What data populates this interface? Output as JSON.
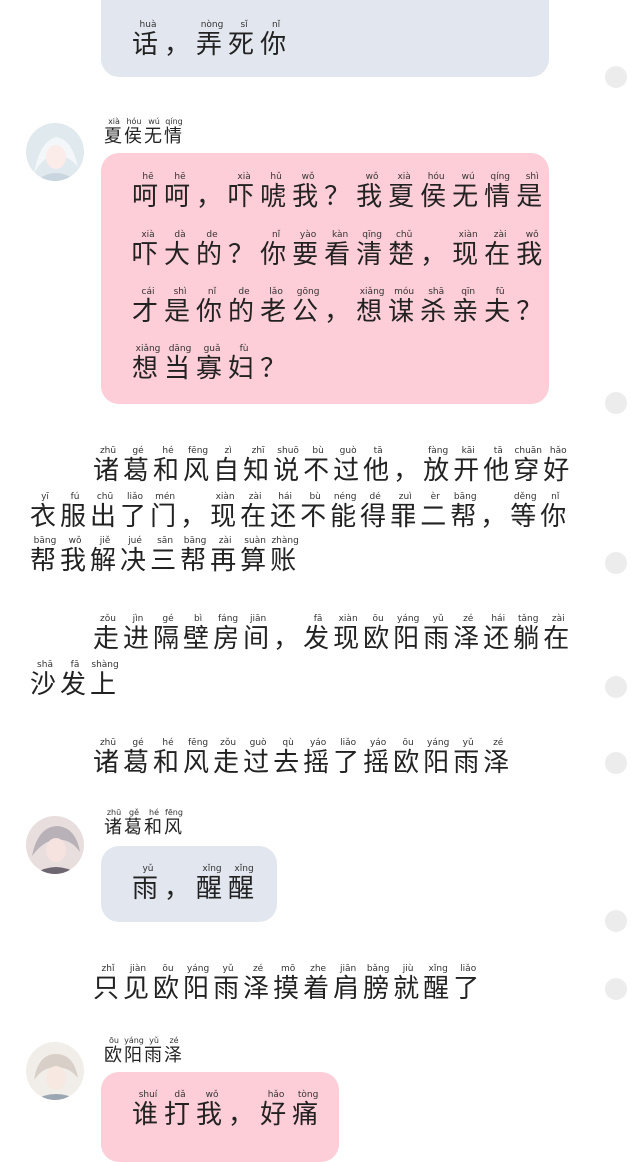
{
  "messages": {
    "m0": {
      "line1": [
        [
          "话",
          "huà"
        ],
        [
          "，",
          ""
        ],
        [
          "弄",
          "nòng"
        ],
        [
          "死",
          "sǐ"
        ],
        [
          "你",
          "nǐ"
        ]
      ]
    },
    "m1": {
      "name": [
        [
          "夏",
          "xià"
        ],
        [
          "侯",
          "hóu"
        ],
        [
          "无",
          "wú"
        ],
        [
          "情",
          "qíng"
        ]
      ],
      "line1": [
        [
          "呵",
          "hē"
        ],
        [
          "呵",
          "hē"
        ],
        [
          "，",
          ""
        ],
        [
          "吓",
          "xià"
        ],
        [
          "唬",
          "hǔ"
        ],
        [
          "我",
          "wǒ"
        ],
        [
          "？",
          ""
        ],
        [
          "我",
          "wǒ"
        ],
        [
          "夏",
          "xià"
        ],
        [
          "侯",
          "hóu"
        ],
        [
          "无",
          "wú"
        ],
        [
          "情",
          "qíng"
        ],
        [
          "是",
          "shì"
        ]
      ],
      "line2": [
        [
          "吓",
          "xià"
        ],
        [
          "大",
          "dà"
        ],
        [
          "的",
          "de"
        ],
        [
          "？",
          ""
        ],
        [
          "你",
          "nǐ"
        ],
        [
          "要",
          "yào"
        ],
        [
          "看",
          "kàn"
        ],
        [
          "清",
          "qīng"
        ],
        [
          "楚",
          "chǔ"
        ],
        [
          "，",
          ""
        ],
        [
          "现",
          "xiàn"
        ],
        [
          "在",
          "zài"
        ],
        [
          "我",
          "wǒ"
        ]
      ],
      "line3": [
        [
          "才",
          "cái"
        ],
        [
          "是",
          "shì"
        ],
        [
          "你",
          "nǐ"
        ],
        [
          "的",
          "de"
        ],
        [
          "老",
          "lǎo"
        ],
        [
          "公",
          "gōng"
        ],
        [
          "，",
          ""
        ],
        [
          "想",
          "xiǎng"
        ],
        [
          "谋",
          "móu"
        ],
        [
          "杀",
          "shā"
        ],
        [
          "亲",
          "qīn"
        ],
        [
          "夫",
          "fū"
        ],
        [
          "？",
          ""
        ]
      ],
      "line4": [
        [
          "想",
          "xiǎng"
        ],
        [
          "当",
          "dāng"
        ],
        [
          "寡",
          "guǎ"
        ],
        [
          "妇",
          "fù"
        ],
        [
          "？",
          ""
        ]
      ]
    },
    "m2": {
      "name": [
        [
          "诸",
          "zhū"
        ],
        [
          "葛",
          "gě"
        ],
        [
          "和",
          "hé"
        ],
        [
          "风",
          "fēng"
        ]
      ],
      "line1": [
        [
          "雨",
          "yǔ"
        ],
        [
          "，",
          ""
        ],
        [
          "醒",
          "xǐng"
        ],
        [
          "醒",
          "xǐng"
        ]
      ]
    },
    "m3": {
      "name": [
        [
          "欧",
          "ōu"
        ],
        [
          "阳",
          "yáng"
        ],
        [
          "雨",
          "yǔ"
        ],
        [
          "泽",
          "zé"
        ]
      ],
      "line1": [
        [
          "谁",
          "shuí"
        ],
        [
          "打",
          "dǎ"
        ],
        [
          "我",
          "wǒ"
        ],
        [
          "，",
          ""
        ],
        [
          "好",
          "hǎo"
        ],
        [
          "痛",
          "tòng"
        ]
      ]
    }
  },
  "narration": {
    "p1": {
      "line1": [
        [
          "诸",
          "zhū"
        ],
        [
          "葛",
          "gé"
        ],
        [
          "和",
          "hé"
        ],
        [
          "风",
          "fēng"
        ],
        [
          "自",
          "zì"
        ],
        [
          "知",
          "zhī"
        ],
        [
          "说",
          "shuō"
        ],
        [
          "不",
          "bù"
        ],
        [
          "过",
          "guò"
        ],
        [
          "他",
          "tā"
        ],
        [
          "，",
          ""
        ],
        [
          "放",
          "fàng"
        ],
        [
          "开",
          "kāi"
        ],
        [
          "他",
          "tā"
        ],
        [
          "穿",
          "chuān"
        ],
        [
          "好",
          "hǎo"
        ]
      ],
      "line2": [
        [
          "衣",
          "yī"
        ],
        [
          "服",
          "fú"
        ],
        [
          "出",
          "chū"
        ],
        [
          "了",
          "liǎo"
        ],
        [
          "门",
          "mén"
        ],
        [
          "，",
          ""
        ],
        [
          "现",
          "xiàn"
        ],
        [
          "在",
          "zài"
        ],
        [
          "还",
          "hái"
        ],
        [
          "不",
          "bù"
        ],
        [
          "能",
          "néng"
        ],
        [
          "得",
          "dé"
        ],
        [
          "罪",
          "zuì"
        ],
        [
          "二",
          "èr"
        ],
        [
          "帮",
          "bāng"
        ],
        [
          "，",
          ""
        ],
        [
          "等",
          "děng"
        ],
        [
          "你",
          "nǐ"
        ]
      ],
      "line3": [
        [
          "帮",
          "bāng"
        ],
        [
          "我",
          "wǒ"
        ],
        [
          "解",
          "jiě"
        ],
        [
          "决",
          "jué"
        ],
        [
          "三",
          "sān"
        ],
        [
          "帮",
          "bāng"
        ],
        [
          "再",
          "zài"
        ],
        [
          "算",
          "suàn"
        ],
        [
          "账",
          "zhàng"
        ]
      ]
    },
    "p2": {
      "line1": [
        [
          "走",
          "zǒu"
        ],
        [
          "进",
          "jìn"
        ],
        [
          "隔",
          "gé"
        ],
        [
          "壁",
          "bì"
        ],
        [
          "房",
          "fáng"
        ],
        [
          "间",
          "jiān"
        ],
        [
          "，",
          ""
        ],
        [
          "发",
          "fā"
        ],
        [
          "现",
          "xiàn"
        ],
        [
          "欧",
          "ōu"
        ],
        [
          "阳",
          "yáng"
        ],
        [
          "雨",
          "yǔ"
        ],
        [
          "泽",
          "zé"
        ],
        [
          "还",
          "hái"
        ],
        [
          "躺",
          "tǎng"
        ],
        [
          "在",
          "zài"
        ]
      ],
      "line2": [
        [
          "沙",
          "shā"
        ],
        [
          "发",
          "fā"
        ],
        [
          "上",
          "shàng"
        ]
      ]
    },
    "p3": {
      "line1": [
        [
          "诸",
          "zhū"
        ],
        [
          "葛",
          "gé"
        ],
        [
          "和",
          "hé"
        ],
        [
          "风",
          "fēng"
        ],
        [
          "走",
          "zǒu"
        ],
        [
          "过",
          "guò"
        ],
        [
          "去",
          "qù"
        ],
        [
          "摇",
          "yáo"
        ],
        [
          "了",
          "liǎo"
        ],
        [
          "摇",
          "yáo"
        ],
        [
          "欧",
          "ōu"
        ],
        [
          "阳",
          "yáng"
        ],
        [
          "雨",
          "yǔ"
        ],
        [
          "泽",
          "zé"
        ]
      ]
    },
    "p4": {
      "line1": [
        [
          "只",
          "zhǐ"
        ],
        [
          "见",
          "jiàn"
        ],
        [
          "欧",
          "ōu"
        ],
        [
          "阳",
          "yáng"
        ],
        [
          "雨",
          "yǔ"
        ],
        [
          "泽",
          "zé"
        ],
        [
          "摸",
          "mō"
        ],
        [
          "着",
          "zhe"
        ],
        [
          "肩",
          "jiān"
        ],
        [
          "膀",
          "bǎng"
        ],
        [
          "就",
          "jiù"
        ],
        [
          "醒",
          "xǐng"
        ],
        [
          "了",
          "liǎo"
        ]
      ]
    }
  },
  "icons": {
    "avatar1": "avatar",
    "avatar2": "avatar",
    "avatar3": "avatar",
    "dot": "scroll-dot"
  },
  "colors": {
    "bubble_blue": "#e2e6ee",
    "bubble_pink": "#fdcdd8",
    "dot": "#ececec"
  }
}
